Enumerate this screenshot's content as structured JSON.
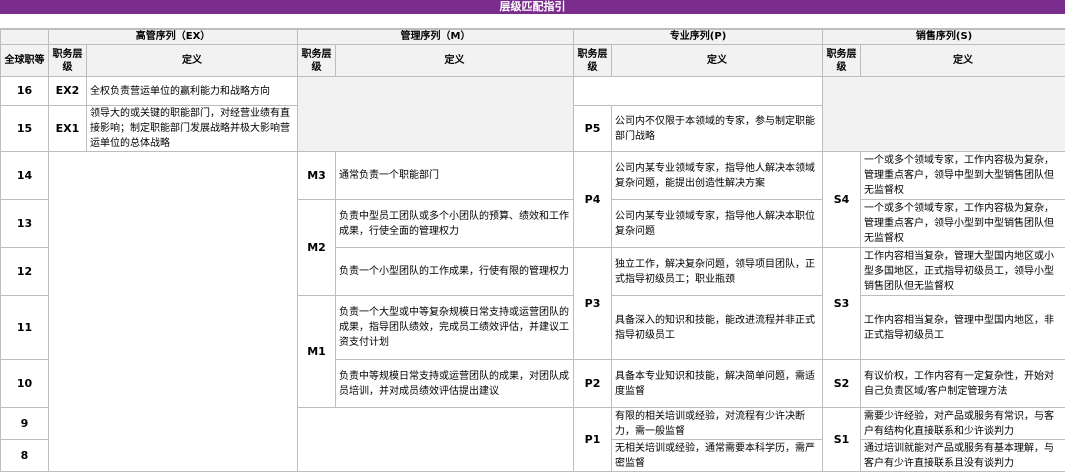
{
  "title": "层级匹配指引",
  "headers": {
    "global_grade": "全球职等",
    "exec": "高管序列（EX）",
    "mgmt": "管理序列（M）",
    "prof": "专业序列(P)",
    "sales": "销售序列(S)",
    "level": "职务层级",
    "definition": "定义"
  },
  "grades": [
    "16",
    "15",
    "14",
    "13",
    "12",
    "11",
    "10",
    "9",
    "8"
  ],
  "exec": [
    {
      "code": "EX2",
      "def": "全权负责营运单位的赢利能力和战略方向"
    },
    {
      "code": "EX1",
      "def": "领导大的或关键的职能部门，对经营业绩有直接影响；制定职能部门发展战略并极大影响营运单位的总体战略"
    }
  ],
  "mgmt": [
    {
      "code": "M3",
      "def": "通常负责一个职能部门"
    },
    {
      "code": "M2",
      "defs": [
        "负责中型员工团队或多个小团队的预算、绩效和工作成果，行使全面的管理权力",
        "负责一个小型团队的工作成果，行使有限的管理权力"
      ]
    },
    {
      "code": "M1",
      "defs": [
        "负责一个大型或中等复杂规模日常支持或运营团队的成果，指导团队绩效，完成员工绩效评估，并建议工资支付计划",
        "负责中等规模日常支持或运营团队的成果，对团队成员培训，并对成员绩效评估提出建议"
      ]
    }
  ],
  "prof": [
    {
      "code": "P5",
      "def": "公司内不仅限于本领域的专家，参与制定职能部门战略"
    },
    {
      "code": "P4",
      "defs": [
        "公司内某专业领域专家，指导他人解决本领域复杂问题，能提出创造性解决方案",
        "公司内某专业领域专家，指导他人解决本职位复杂问题"
      ]
    },
    {
      "code": "P3",
      "defs": [
        "独立工作，解决复杂问题，领导项目团队，正式指导初级员工；职业瓶颈",
        "具备深入的知识和技能，能改进流程并非正式指导初级员工"
      ]
    },
    {
      "code": "P2",
      "def": "具备本专业知识和技能，解决简单问题，需适度监督"
    },
    {
      "code": "P1",
      "defs": [
        "有限的相关培训或经验，对流程有少许决断力，需一般监督",
        "无相关培训或经验，通常需要本科学历，需严密监督"
      ]
    }
  ],
  "sales": [
    {
      "code": "S4",
      "defs": [
        "一个或多个领域专家，工作内容极为复杂，管理重点客户，领导中型到大型销售团队但无监督权",
        "一个或多个领域专家，工作内容极为复杂，管理重点客户，领导小型到中型销售团队但无监督权"
      ]
    },
    {
      "code": "S3",
      "defs": [
        "工作内容相当复杂，管理大型国内地区或小型多国地区，正式指导初级员工，领导小型销售团队但无监督权",
        "工作内容相当复杂，管理中型国内地区，非正式指导初级员工"
      ]
    },
    {
      "code": "S2",
      "def": "有议价权，工作内容有一定复杂性，开始对自己负责区域/客户制定管理方法"
    },
    {
      "code": "S1",
      "defs": [
        "需要少许经验，对产品或服务有常识，与客户有结构化直接联系和少许谈判力",
        "通过培训就能对产品或服务有基本理解，与客户有少许直接联系且没有谈判力"
      ]
    }
  ]
}
